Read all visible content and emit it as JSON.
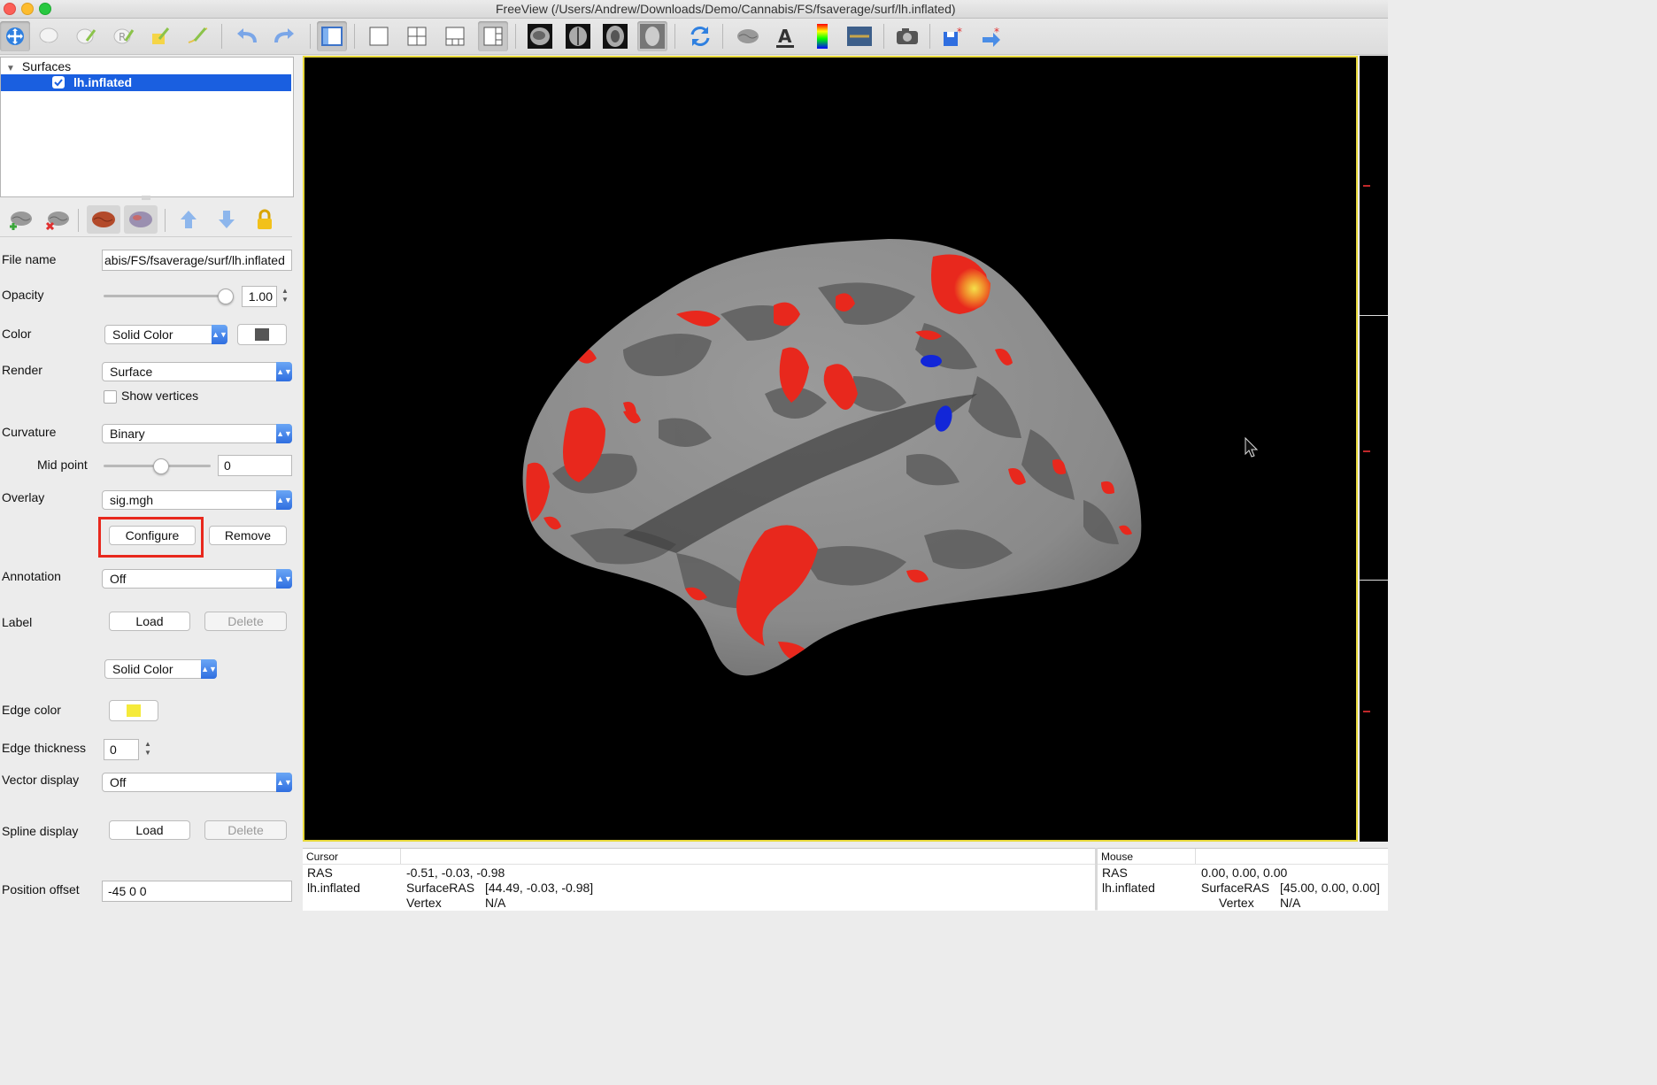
{
  "window": {
    "title": "FreeView (/Users/Andrew/Downloads/Demo/Cannabis/FS/fsaverage/surf/lh.inflated)"
  },
  "toolbar": {
    "tools": [
      "navigate-tool-icon",
      "freehand-tool-icon",
      "voxel-edit-icon",
      "recon-edit-icon",
      "roi-edit-icon",
      "point-set-edit-icon",
      "undo-icon",
      "redo-icon",
      "toggle-panel-icon",
      "layout-1x1-icon",
      "layout-2x2-icon",
      "layout-1-3-icon",
      "layout-1-3h-icon",
      "sagittal-view-icon",
      "coronal-view-icon",
      "axial-view-icon",
      "3d-view-icon",
      "reset-view-icon",
      "show-surface-icon",
      "show-text-icon",
      "color-bar-icon",
      "show-coord-icon",
      "screenshot-icon",
      "save-point-icon",
      "goto-point-icon"
    ]
  },
  "layer_tree": {
    "group": "Surfaces",
    "items": [
      {
        "name": "lh.inflated",
        "checked": true,
        "selected": true
      }
    ]
  },
  "properties": {
    "file_name_label": "File name",
    "file_name_value": "abis/FS/fsaverage/surf/lh.inflated",
    "opacity_label": "Opacity",
    "opacity_value": "1.00",
    "opacity_level": 1.0,
    "color_label": "Color",
    "color_mode": "Solid Color",
    "color_swatch": "#555555",
    "render_label": "Render",
    "render_value": "Surface",
    "show_vertices_label": "Show vertices",
    "curvature_label": "Curvature",
    "curvature_value": "Binary",
    "mid_point_label": "Mid point",
    "mid_point_value": "0",
    "overlay_label": "Overlay",
    "overlay_value": "sig.mgh",
    "configure_label": "Configure",
    "remove_label": "Remove",
    "annotation_label": "Annotation",
    "annotation_value": "Off",
    "label_label": "Label",
    "label_load": "Load",
    "label_delete": "Delete",
    "label_color_mode": "Solid Color",
    "edge_color_label": "Edge color",
    "edge_color": "#f5ea3a",
    "edge_thickness_label": "Edge thickness",
    "edge_thickness_value": "0",
    "vector_display_label": "Vector display",
    "vector_display_value": "Off",
    "spline_display_label": "Spline display",
    "spline_load": "Load",
    "spline_delete": "Delete",
    "position_offset_label": "Position offset",
    "position_offset_value": "-45 0 0"
  },
  "cursor_info": {
    "header": "Cursor",
    "rows": [
      {
        "name": "RAS",
        "key": "-0.51, -0.03, -0.98",
        "value": ""
      },
      {
        "name": "lh.inflated",
        "key": "SurfaceRAS",
        "value": "[44.49, -0.03, -0.98]"
      },
      {
        "name": "",
        "key": "Vertex",
        "value": "N/A"
      }
    ]
  },
  "mouse_info": {
    "header": "Mouse",
    "rows": [
      {
        "name": "RAS",
        "key": "0.00, 0.00, 0.00",
        "value": ""
      },
      {
        "name": "lh.inflated",
        "key": "SurfaceRAS",
        "value": "[45.00, 0.00, 0.00]"
      },
      {
        "name": "",
        "key": "Vertex",
        "value": "N/A"
      }
    ]
  },
  "colors": {
    "selection": "#1a5fe0",
    "highlight_box": "#e8281d",
    "viewport_border": "#e8d93a",
    "activation": "#e8281d",
    "deactivation": "#1226d8"
  }
}
